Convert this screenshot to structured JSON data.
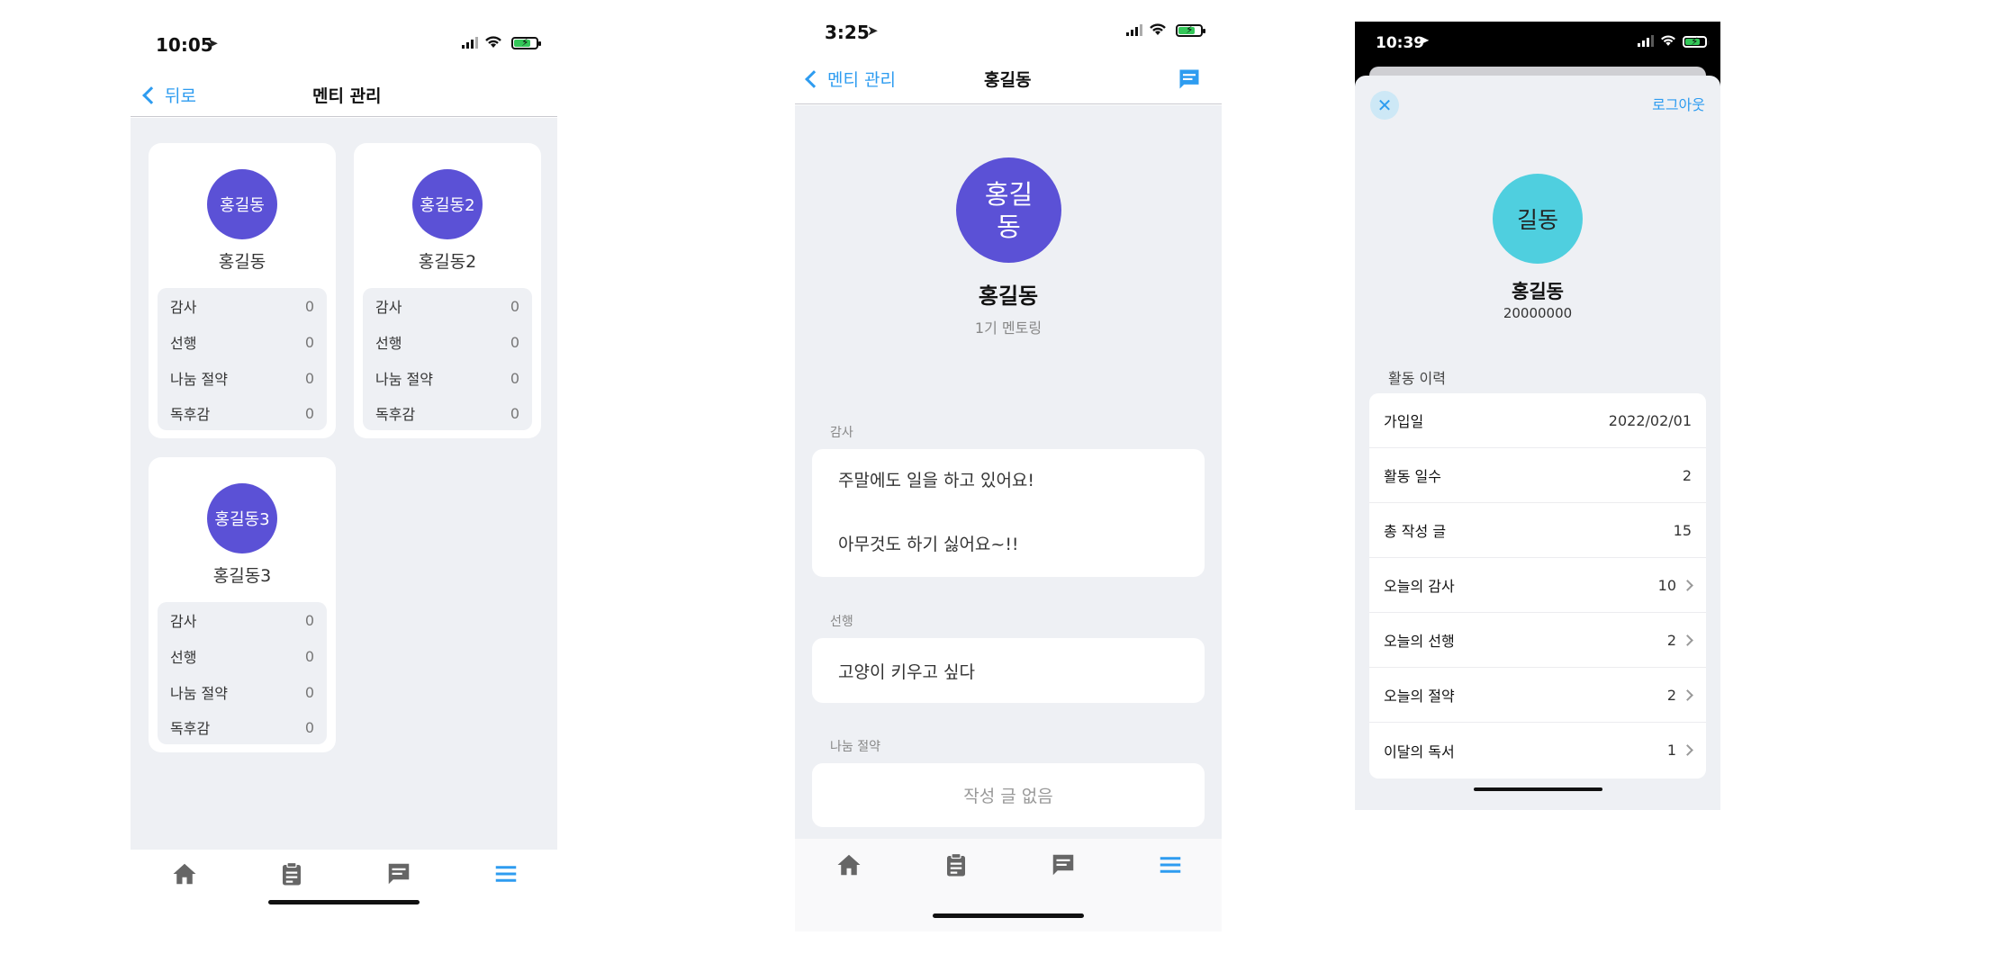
{
  "colors": {
    "accent": "#2e9cf0",
    "avatar_purple": "#5b51d6",
    "avatar_cyan": "#4fcfdf",
    "background": "#eef0f4"
  },
  "tabbar_icons": [
    "home-icon",
    "clipboard-icon",
    "chat-icon",
    "menu-icon"
  ],
  "screen1": {
    "status_time": "10:05",
    "back_label": "뒤로",
    "title": "멘티 관리",
    "mentees": [
      {
        "avatar_text": "홍길동",
        "name": "홍길동",
        "stats": [
          {
            "label": "감사",
            "value": "0"
          },
          {
            "label": "선행",
            "value": "0"
          },
          {
            "label": "나눔 절약",
            "value": "0"
          },
          {
            "label": "독후감",
            "value": "0"
          }
        ]
      },
      {
        "avatar_text": "홍길동2",
        "name": "홍길동2",
        "stats": [
          {
            "label": "감사",
            "value": "0"
          },
          {
            "label": "선행",
            "value": "0"
          },
          {
            "label": "나눔 절약",
            "value": "0"
          },
          {
            "label": "독후감",
            "value": "0"
          }
        ]
      },
      {
        "avatar_text": "홍길동3",
        "name": "홍길동3",
        "stats": [
          {
            "label": "감사",
            "value": "0"
          },
          {
            "label": "선행",
            "value": "0"
          },
          {
            "label": "나눔 절약",
            "value": "0"
          },
          {
            "label": "독후감",
            "value": "0"
          }
        ]
      }
    ]
  },
  "screen2": {
    "status_time": "3:25",
    "back_label": "멘티 관리",
    "title": "홍길동",
    "avatar_text": "홍길동",
    "name": "홍길동",
    "subtitle": "1기 멘토링",
    "sections": [
      {
        "label": "감사",
        "lines": [
          "주말에도 일을 하고 있어요!",
          "아무것도 하기 싫어요~!!"
        ]
      },
      {
        "label": "선행",
        "lines": [
          "고양이 키우고 싶다"
        ]
      },
      {
        "label": "나눔 절약",
        "empty_text": "작성 글 없음"
      }
    ]
  },
  "screen3": {
    "status_time": "10:39",
    "close_label": "✕",
    "logout_label": "로그아웃",
    "avatar_text": "길동",
    "name": "홍길동",
    "user_id": "20000000",
    "activity_label": "활동 이력",
    "rows": [
      {
        "label": "가입일",
        "value": "2022/02/01"
      },
      {
        "label": "활동 일수",
        "value": "2"
      },
      {
        "label": "총 작성 글",
        "value": "15"
      },
      {
        "label": "오늘의 감사",
        "value": "10"
      },
      {
        "label": "오늘의 선행",
        "value": "2"
      },
      {
        "label": "오늘의 절약",
        "value": "2"
      },
      {
        "label": "이달의 독서",
        "value": "1"
      }
    ]
  }
}
